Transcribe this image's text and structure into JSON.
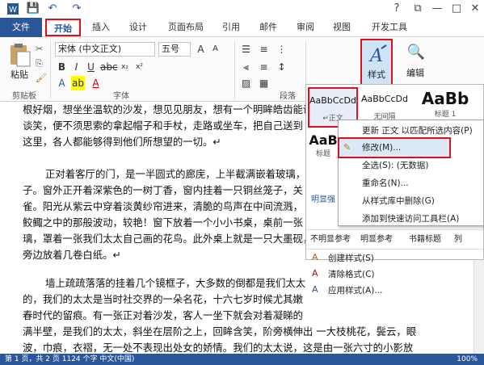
{
  "quick_access": {
    "save": "💾",
    "undo": "↶",
    "redo": "↷"
  },
  "window_controls": {
    "help": "?",
    "restore": "⧉",
    "minimize": "—",
    "maximize": "□",
    "close": "✕"
  },
  "tabs": [
    "文件",
    "开始",
    "插入",
    "设计",
    "页面布局",
    "引用",
    "邮件",
    "审阅",
    "视图",
    "开发工具"
  ],
  "ribbon": {
    "paste": "粘贴",
    "clipboard": "剪贴板",
    "font_name": "宋体 (中文正文)",
    "font_size": "五号",
    "font": "字体",
    "paragraph": "段落",
    "styles": "样式",
    "edit": "编辑"
  },
  "document": {
    "lines": [
      "根好烟，想坐坐温软的沙发，想见见朋友，想有一个明眸皓齿能说",
      "谈笑，便不须思索的拿起帽子和手杖，走路或坐车，把自己送到",
      "这里，各人都能够得到他们所想望的一切。↵",
      "",
      "正对着客厅的门，是一半圆式的廊庑，上半截满嵌着玻璃，",
      "子。窗外正开着深紫色的一树丁香，窗内挂着一只铜丝笼子，关",
      "雀。阳光从紫云中穿着淡黄纱帘进来，清脆的鸟声在中间流溅，",
      "鲛鲰之中的那般波动，较艳！窗下放着一个小小书桌，桌前一张",
      "璃，罩着一张我们太太自己画的花鸟。此外桌上就是一只大墨砚，",
      "旁边放着几卷白纸。↵",
      "",
      "墙上疏疏落落的挂着几个镜框子，大多数的倒都是我们太太",
      "的，我们的太太是当时社交界的一朵名花，十六七岁时候尤其嫩",
      "春时代的留痕。有一张正对着沙发，客人一坐下就会对着凝睇的",
      "满半壁，是我们的太太，斜坐在层阶之上，回眸含笑，阶旁横伸出 一大枝桃花，鬓云，眼",
      "波，巾痕，衣褶，无一处不表现出处女的娇情。我们的太太说，这是由一张六寸的小影放"
    ]
  },
  "styles_gallery": {
    "row1": [
      {
        "sample": "AaBbCcDd",
        "name": "↵正文"
      },
      {
        "sample": "AaBbCcDd",
        "name": "无间隔"
      },
      {
        "sample": "AaBb",
        "name": "标题 1"
      }
    ],
    "row2": [
      {
        "sample": "AaB",
        "name": "标题"
      }
    ],
    "row3": [
      "明显强调"
    ],
    "row4": [
      "不明显参考",
      "明显参考",
      "书籍标题",
      "列"
    ]
  },
  "context_menu": [
    "更新 正文 以匹配所选内容(P)",
    "修改(M)...",
    "全选(S): (无数据)",
    "重命名(N)...",
    "从样式库中删除(G)",
    "添加到快速访问工具栏(A)"
  ],
  "gallery_bottom": [
    "创建样式(S)",
    "清除格式(C)",
    "应用样式(A)..."
  ],
  "status": {
    "text": "第 1 页，共 2 页     1124 个字     中文(中国)",
    "zoom": "100%"
  },
  "colors": {
    "accent": "#2b579a",
    "highlight": "#e0101a"
  }
}
